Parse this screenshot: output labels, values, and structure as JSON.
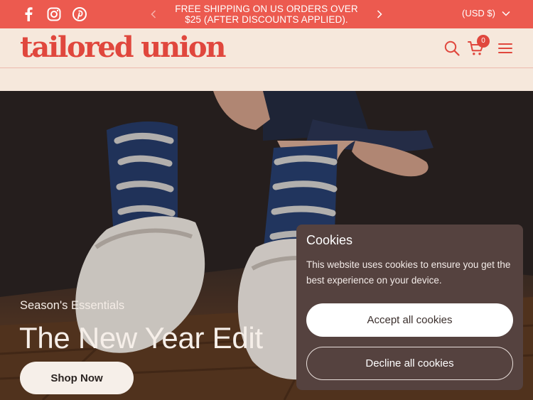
{
  "colors": {
    "announcement_bg": "#ec5a4f",
    "brand": "#e0473d",
    "header_bg": "#f6e8dc",
    "cookie_panel_bg": "#55423f"
  },
  "announcement": {
    "social_icons": [
      "facebook-icon",
      "instagram-icon",
      "pinterest-icon"
    ],
    "message": "FREE SHIPPING ON US ORDERS OVER $25 (AFTER DISCOUNTS APPLIED).",
    "currency": "(USD $)"
  },
  "header": {
    "logo": "tailored union",
    "icons": [
      "search-icon",
      "cart-icon",
      "menu-icon"
    ],
    "cart_count": "0"
  },
  "hero": {
    "subtitle": "Season's Essentials",
    "title": "The New Year Edit",
    "cta": "Shop Now"
  },
  "cookies": {
    "title": "Cookies",
    "text": "This website uses cookies to ensure you get the best experience on your device.",
    "accept": "Accept all cookies",
    "decline": "Decline all cookies"
  }
}
